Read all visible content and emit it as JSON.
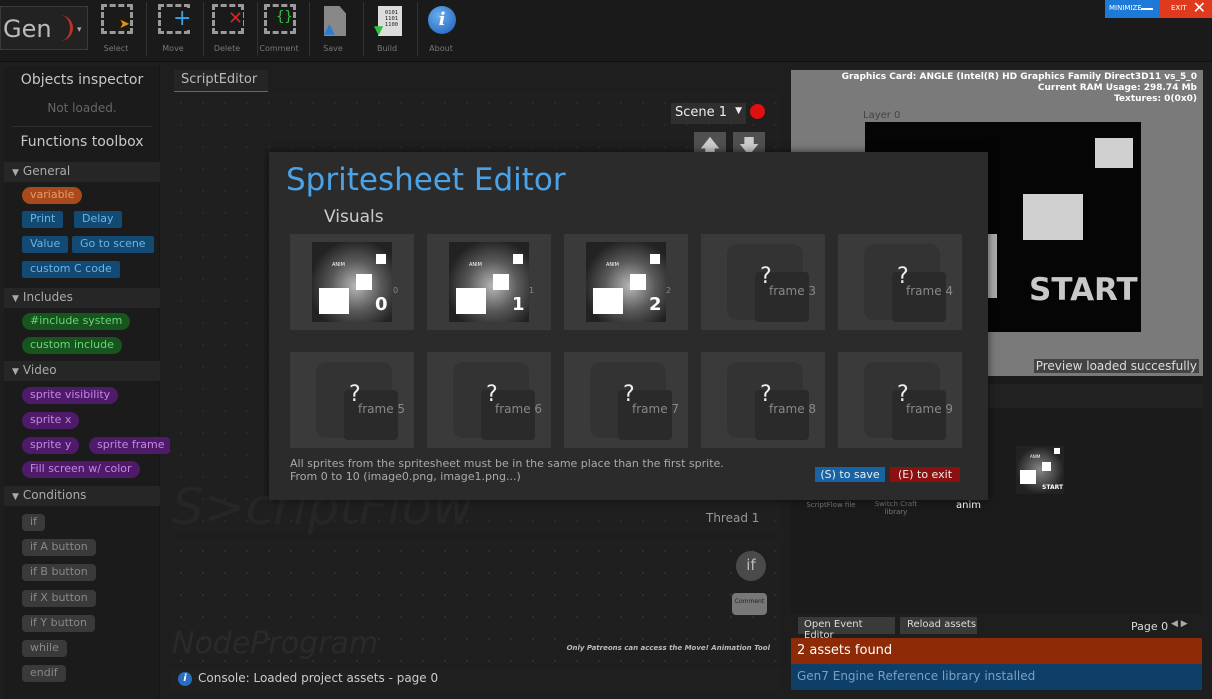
{
  "app": {
    "logo_text": "Gen",
    "toolbar": [
      {
        "label": "Select",
        "icon": "select-icon"
      },
      {
        "label": "Move",
        "icon": "move-icon"
      },
      {
        "label": "Delete",
        "icon": "delete-icon"
      },
      {
        "label": "Comment",
        "icon": "comment-icon"
      },
      {
        "label": "Save",
        "icon": "save-icon"
      },
      {
        "label": "Build",
        "icon": "build-icon"
      },
      {
        "label": "About",
        "icon": "info-icon"
      }
    ],
    "build_icon_text": "0101\n1101\n1100",
    "window": {
      "minimize_label": "MINIMIZE",
      "exit_label": "EXIT"
    }
  },
  "left": {
    "objects_title": "Objects inspector",
    "objects_note": "Not loaded.",
    "functions_title": "Functions toolbox",
    "categories": [
      {
        "name": "General"
      },
      {
        "name": "Includes"
      },
      {
        "name": "Video"
      },
      {
        "name": "Conditions"
      }
    ],
    "general": [
      "variable",
      "Print",
      "Delay",
      "Value",
      "Go to scene",
      "custom C code"
    ],
    "includes": [
      "#include system",
      "custom include"
    ],
    "video": [
      "sprite visibility",
      "sprite x",
      "sprite y",
      "sprite frame",
      "Fill screen w/ color"
    ],
    "conditions": [
      "if",
      "if A button",
      "if B button",
      "if X button",
      "if Y button",
      "while",
      "endif"
    ]
  },
  "center": {
    "tab": "ScriptEditor",
    "scene": "Scene 1",
    "scriptflow_watermark": "S>criptFlow",
    "thread": "Thread 1",
    "nodeprogram_watermark": "NodeProgram",
    "if_node": "if",
    "comment_node": "Comment",
    "patreon_note": "Only Patreons can access the Move! Animation Tool",
    "console": "Console: Loaded project assets - page 0"
  },
  "preview": {
    "info_lines": [
      "Graphics Card: ANGLE (Intel(R) HD Graphics Family Direct3D11 vs_5_0",
      "Current RAM Usage: 298.74 Mb",
      "Textures: 0(0x0)"
    ],
    "layer": "Layer 0",
    "start": "START",
    "status": "Preview loaded succesfully"
  },
  "assets": {
    "labels": [
      "ScriptFlow file",
      "Switch Craft library",
      "anim"
    ],
    "question": "?",
    "open_events": "Open Event Editor",
    "reload": "Reload assets",
    "page": "Page 0",
    "page_arrows": "◀ ▶",
    "found": "2 assets found",
    "library": "Gen7 Engine Reference library installed",
    "thumb_anim": "ANIM",
    "thumb_start": "START"
  },
  "modal": {
    "title": "Spritesheet Editor",
    "subtitle": "Visuals",
    "frames": [
      {
        "kind": "sprite",
        "anim": "ANIM",
        "num": "0",
        "side": "0"
      },
      {
        "kind": "sprite",
        "anim": "ANIM",
        "num": "1",
        "side": "1"
      },
      {
        "kind": "sprite",
        "anim": "ANIM",
        "num": "2",
        "side": "2"
      },
      {
        "kind": "empty",
        "label": "frame 3",
        "q": "?"
      },
      {
        "kind": "empty",
        "label": "frame 4",
        "q": "?"
      },
      {
        "kind": "empty",
        "label": "frame 5",
        "q": "?"
      },
      {
        "kind": "empty",
        "label": "frame 6",
        "q": "?"
      },
      {
        "kind": "empty",
        "label": "frame 7",
        "q": "?"
      },
      {
        "kind": "empty",
        "label": "frame 8",
        "q": "?"
      },
      {
        "kind": "empty",
        "label": "frame 9",
        "q": "?"
      }
    ],
    "note_line1": "All sprites from the spritesheet must be in the same place than the first sprite.",
    "note_line2": "From 0 to 10 (image0.png, image1.png...)",
    "save_label": "(S) to save",
    "exit_label": "(E) to exit"
  },
  "colors": {
    "accent": "#4aa3e8",
    "record": "#e01010",
    "assets_bar": "#8e2a05",
    "library_bar": "#0d3f69"
  }
}
